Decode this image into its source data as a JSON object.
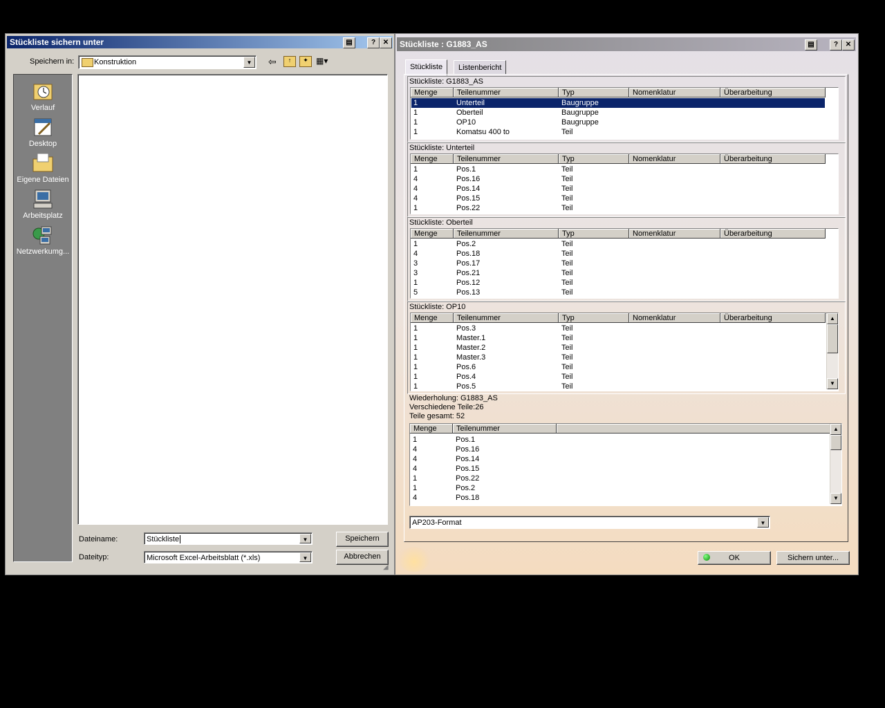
{
  "save_dialog": {
    "title": "Stückliste sichern unter",
    "save_in_label": "Speichern in:",
    "save_in_value": "Konstruktion",
    "places": [
      {
        "label": "Verlauf",
        "icon": "history-icon"
      },
      {
        "label": "Desktop",
        "icon": "desktop-icon"
      },
      {
        "label": "Eigene Dateien",
        "icon": "my-documents-icon"
      },
      {
        "label": "Arbeitsplatz",
        "icon": "my-computer-icon"
      },
      {
        "label": "Netzwerkumg...",
        "icon": "network-icon"
      }
    ],
    "filename_label": "Dateiname:",
    "filename_value": "Stückliste",
    "filetype_label": "Dateityp:",
    "filetype_value": "Microsoft Excel-Arbeitsblatt (*.xls)",
    "save_button": "Speichern",
    "cancel_button": "Abbrechen",
    "help_glyph": "?",
    "close_glyph": "✕"
  },
  "bom_dialog": {
    "title": "Stückliste : G1883_AS",
    "help_glyph": "?",
    "close_glyph": "✕",
    "tabs": [
      "Stückliste",
      "Listenbericht"
    ],
    "columns": [
      "Menge",
      "Teilenummer",
      "Typ",
      "Nomenklatur",
      "Überarbeitung"
    ],
    "sections": [
      {
        "title": "Stückliste: G1883_AS",
        "rows": [
          [
            "1",
            "Unterteil",
            "Baugruppe"
          ],
          [
            "1",
            "Oberteil",
            "Baugruppe"
          ],
          [
            "1",
            "OP10",
            "Baugruppe"
          ],
          [
            "1",
            "Komatsu 400 to",
            "Teil"
          ]
        ]
      },
      {
        "title": "Stückliste: Unterteil",
        "rows": [
          [
            "1",
            "Pos.1",
            "Teil"
          ],
          [
            "4",
            "Pos.16",
            "Teil"
          ],
          [
            "4",
            "Pos.14",
            "Teil"
          ],
          [
            "4",
            "Pos.15",
            "Teil"
          ],
          [
            "1",
            "Pos.22",
            "Teil"
          ]
        ]
      },
      {
        "title": "Stückliste: Oberteil",
        "rows": [
          [
            "1",
            "Pos.2",
            "Teil"
          ],
          [
            "4",
            "Pos.18",
            "Teil"
          ],
          [
            "3",
            "Pos.17",
            "Teil"
          ],
          [
            "3",
            "Pos.21",
            "Teil"
          ],
          [
            "1",
            "Pos.12",
            "Teil"
          ],
          [
            "5",
            "Pos.13",
            "Teil"
          ]
        ]
      },
      {
        "title": "Stückliste: OP10",
        "rows": [
          [
            "1",
            "Pos.3",
            "Teil"
          ],
          [
            "1",
            "Master.1",
            "Teil"
          ],
          [
            "1",
            "Master.2",
            "Teil"
          ],
          [
            "1",
            "Master.3",
            "Teil"
          ],
          [
            "1",
            "Pos.6",
            "Teil"
          ],
          [
            "1",
            "Pos.4",
            "Teil"
          ],
          [
            "1",
            "Pos.5",
            "Teil"
          ]
        ]
      }
    ],
    "summary": {
      "line1": "Wiederholung: G1883_AS",
      "line2": "Verschiedene Teile:26",
      "line3": "Teile gesamt: 52",
      "columns": [
        "Menge",
        "Teilenummer"
      ],
      "rows": [
        [
          "1",
          "Pos.1"
        ],
        [
          "4",
          "Pos.16"
        ],
        [
          "4",
          "Pos.14"
        ],
        [
          "4",
          "Pos.15"
        ],
        [
          "1",
          "Pos.22"
        ],
        [
          "1",
          "Pos.2"
        ],
        [
          "4",
          "Pos.18"
        ]
      ]
    },
    "format_value": "AP203-Format",
    "ok_button": "OK",
    "save_as_button": "Sichern unter..."
  }
}
